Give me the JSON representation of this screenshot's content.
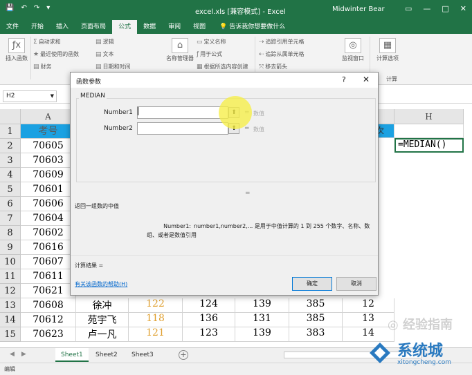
{
  "title_bar": {
    "doc_title": "excel.xls  [兼容模式] - Excel",
    "user": "Midwinter Bear",
    "quick_icons": [
      "💾",
      "↶",
      "↷",
      "▾"
    ],
    "win_controls": [
      "▭",
      "—",
      "□",
      "✕"
    ]
  },
  "tabs": {
    "items": [
      "文件",
      "开始",
      "插入",
      "页面布局",
      "公式",
      "数据",
      "审阅",
      "视图"
    ],
    "active": "公式",
    "tell_me": "💡 告诉我你想要做什么"
  },
  "ribbon": {
    "insert_function": "插入函数",
    "autosum": "自动求和",
    "recent": "最近使用的函数",
    "financial": "财务",
    "logical": "逻辑",
    "text": "文本",
    "datetime": "日期和时间",
    "name_manager": "名称管理器",
    "define_name": "定义名称",
    "use_in_formula": "用于公式",
    "create_from_selection": "根据所选内容创建",
    "trace_precedents": "追踪引用单元格",
    "trace_dependents": "追踪从属单元格",
    "remove_arrows": "移去箭头",
    "watch_window": "监视窗口",
    "calc_options": "计算选项",
    "calc_group": "计算"
  },
  "formula_bar": {
    "name_box": "H2"
  },
  "columns": [
    "A",
    "H"
  ],
  "rows": [
    "1",
    "2",
    "3",
    "4",
    "5",
    "6",
    "7",
    "8",
    "9",
    "10",
    "11",
    "12",
    "13",
    "14",
    "15"
  ],
  "column_a": [
    "考号",
    "70605",
    "70603",
    "70609",
    "70601",
    "70606",
    "70604",
    "70602",
    "70616",
    "70607",
    "70611",
    "70621",
    "70608",
    "70612",
    "70623"
  ],
  "h2_formula": "=MEDIAN()",
  "partial_right_header": "次",
  "lower_rows": [
    {
      "name": "徐冲",
      "c": "122",
      "d": "124",
      "e": "139",
      "f": "385",
      "g": "12"
    },
    {
      "name": "苑宇飞",
      "c": "118",
      "d": "136",
      "e": "131",
      "f": "385",
      "g": "13"
    },
    {
      "name": "卢一凡",
      "c": "121",
      "d": "123",
      "e": "139",
      "f": "383",
      "g": "14"
    }
  ],
  "sheets": {
    "tabs": [
      "Sheet1",
      "Sheet2",
      "Sheet3"
    ],
    "active": "Sheet1",
    "add": "+"
  },
  "status": "编辑",
  "dialog": {
    "title": "函数参数",
    "help_q": "?",
    "close": "✕",
    "function_name": "MEDIAN",
    "args": [
      {
        "label": "Number1",
        "eq": "=",
        "hint": "数值"
      },
      {
        "label": "Number2",
        "eq": "=",
        "hint": "数值"
      }
    ],
    "result_eq": "=",
    "description": "返回一组数的中值",
    "arg_name": "Number1:",
    "arg_desc": "number1,number2,... 是用于中值计算的 1 到 255 个数字、名称、数组、或者是数值引用",
    "calc_result": "计算结果 =",
    "help_link": "有关该函数的帮助(H)",
    "ok": "确定",
    "cancel": "取消"
  },
  "watermark": {
    "brand": "系统城",
    "url": "xitongcheng.com",
    "faint": "◎ 经验指南"
  },
  "colors": {
    "excel_green": "#217346",
    "header_blue": "#1ba1e2",
    "orange_value": "#e0a030"
  }
}
